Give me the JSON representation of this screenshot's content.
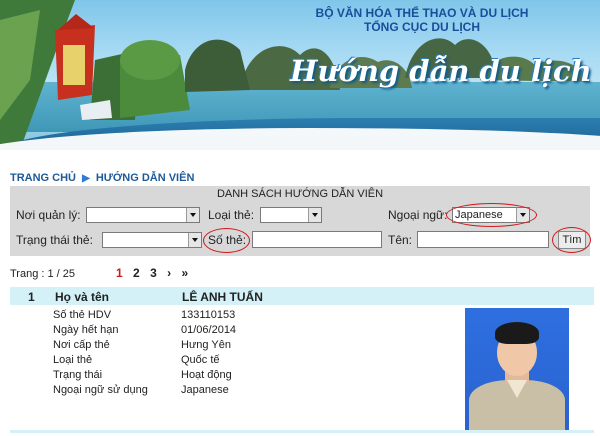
{
  "header": {
    "org_line1": "BỘ VĂN HÓA THỂ THAO VÀ DU LỊCH",
    "org_line2": "TỔNG CỤC DU LỊCH",
    "slogan": "Hướng dẫn du lịch"
  },
  "breadcrumb": {
    "home": "TRANG CHỦ",
    "current": "HƯỚNG DẪN VIÊN"
  },
  "search": {
    "title": "DANH SÁCH HƯỚNG DẪN VIÊN",
    "noi_quan_ly_label": "Nơi quản lý:",
    "noi_quan_ly_value": "",
    "loai_the_label": "Loại thẻ:",
    "loai_the_value": "",
    "ngoai_ngu_label": "Ngoại ngữ:",
    "ngoai_ngu_value": "Japanese",
    "trang_thai_label": "Trạng thái thẻ:",
    "trang_thai_value": "",
    "so_the_label": "Số thẻ:",
    "so_the_value": "",
    "ten_label": "Tên:",
    "ten_value": "",
    "search_button": "Tìm"
  },
  "pagination": {
    "summary": "Trang : 1 / 25",
    "pages": [
      "1",
      "2",
      "3"
    ],
    "current": "1",
    "next": "›",
    "last": "»"
  },
  "result": {
    "index": "1",
    "name_label": "Họ và tên",
    "name_value": "LÊ ANH TUẤN",
    "fields": [
      {
        "label": "Số thẻ HDV",
        "value": "133110153"
      },
      {
        "label": "Ngày hết hạn",
        "value": "01/06/2014"
      },
      {
        "label": "Nơi cấp thẻ",
        "value": "Hưng Yên"
      },
      {
        "label": "Loại thẻ",
        "value": "Quốc tế"
      },
      {
        "label": "Trạng thái",
        "value": "Hoạt động"
      },
      {
        "label": "Ngoại ngữ sử dụng",
        "value": "Japanese"
      }
    ]
  },
  "colors": {
    "header_blue": "#1a4d9a",
    "breadcrumb_blue": "#1d5a9a",
    "panel_gray": "#d8d8d8",
    "highlight_red": "#d0191d",
    "result_band": "#d4f1f7"
  }
}
